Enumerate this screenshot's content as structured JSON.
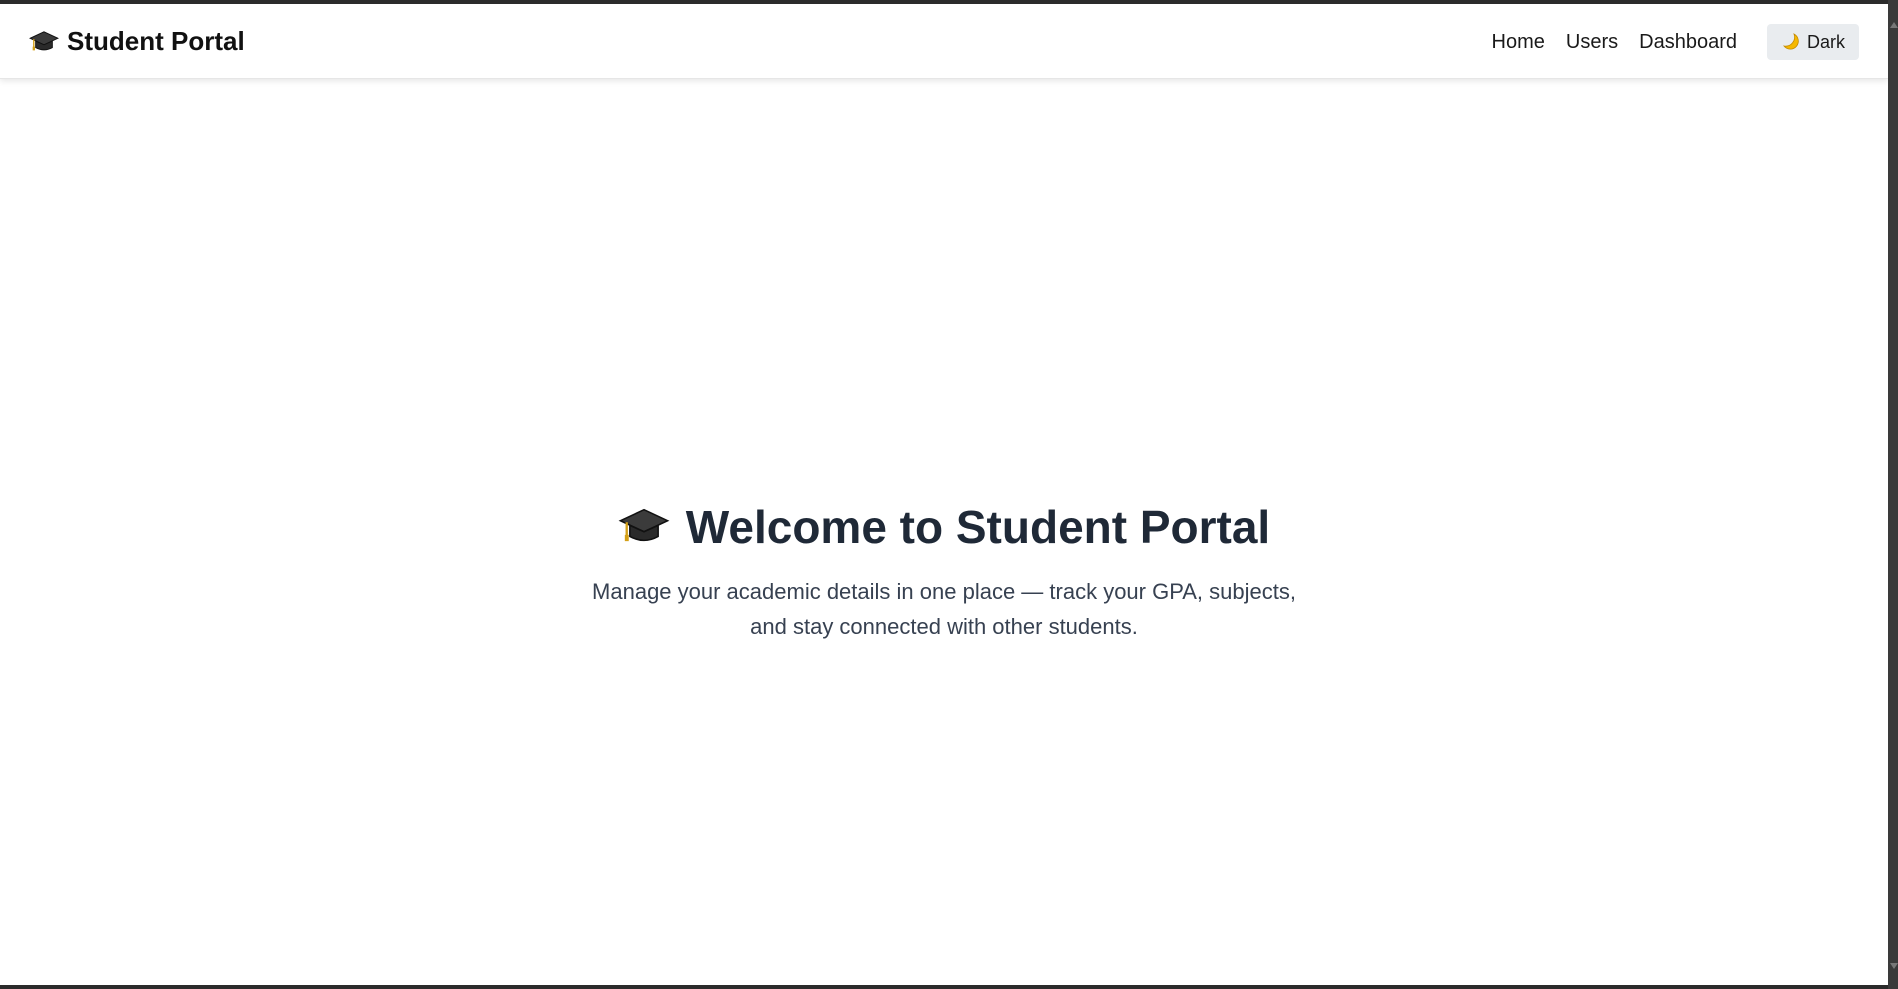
{
  "navbar": {
    "brand_icon": "graduation-cap-icon",
    "brand_title": "Student Portal",
    "links": [
      {
        "label": "Home"
      },
      {
        "label": "Users"
      },
      {
        "label": "Dashboard"
      }
    ],
    "theme_toggle": {
      "icon": "moon-icon",
      "label": "Dark"
    }
  },
  "hero": {
    "icon": "graduation-cap-icon",
    "title": "Welcome to Student Portal",
    "subtitle": "Manage your academic details in one place — track your GPA, subjects, and stay connected with other students."
  },
  "colors": {
    "heading": "#1f2937",
    "body_text": "#374151",
    "toggle_bg": "#e9ecef"
  }
}
